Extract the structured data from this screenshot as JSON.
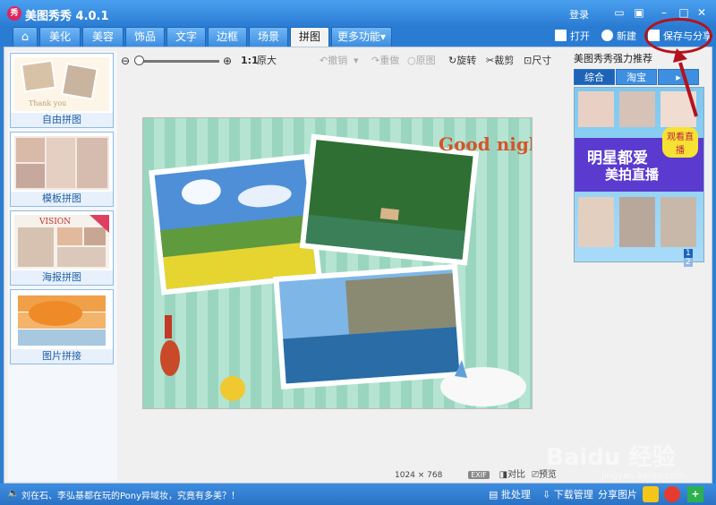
{
  "titlebar": {
    "title": "美图秀秀 4.0.1",
    "logo": "秀",
    "login": "登录"
  },
  "tabs": [
    {
      "label": "⌂"
    },
    {
      "label": "美化"
    },
    {
      "label": "美容"
    },
    {
      "label": "饰品"
    },
    {
      "label": "文字"
    },
    {
      "label": "边框"
    },
    {
      "label": "场景"
    },
    {
      "label": "拼图"
    },
    {
      "label": "更多功能▾"
    }
  ],
  "top_actions": {
    "open": "打开",
    "new": "新建",
    "save_share": "保存与分享"
  },
  "left_modes": [
    {
      "label": "自由拼图"
    },
    {
      "label": "模板拼图"
    },
    {
      "label": "海报拼图"
    },
    {
      "label": "图片拼接"
    }
  ],
  "toolbar": {
    "zoom_ratio": "1:1",
    "original_size": "原大",
    "undo": "撤销",
    "redo": "重做",
    "original": "原图",
    "rotate": "旋转",
    "crop": "裁剪",
    "size": "尺寸"
  },
  "canvas": {
    "goodnight": "Good night"
  },
  "status": {
    "dimensions": "1024 × 768",
    "exif": "EXIF",
    "compare": "对比",
    "preview": "预览"
  },
  "right_panel": {
    "title": "美图秀秀强力推荐",
    "tabs": [
      "综合",
      "淘宝",
      "▸"
    ],
    "ad_line1": "明星都爱",
    "ad_line2": "美拍直播",
    "ad_badge": "观看直播",
    "pages": [
      "1",
      "2"
    ]
  },
  "bottom": {
    "news": "刘在石、李弘基都在玩的Pony异域妆，究竟有多美？！",
    "batch": "批处理",
    "download": "下载管理",
    "share_image": "分享图片"
  },
  "watermark": {
    "main": "Baidu 经验",
    "sub": "jingyan.baidu.com"
  },
  "colors": {
    "titlebar": "#2a7cd3",
    "accent": "#1d64b8",
    "annotation": "#b5121b"
  }
}
